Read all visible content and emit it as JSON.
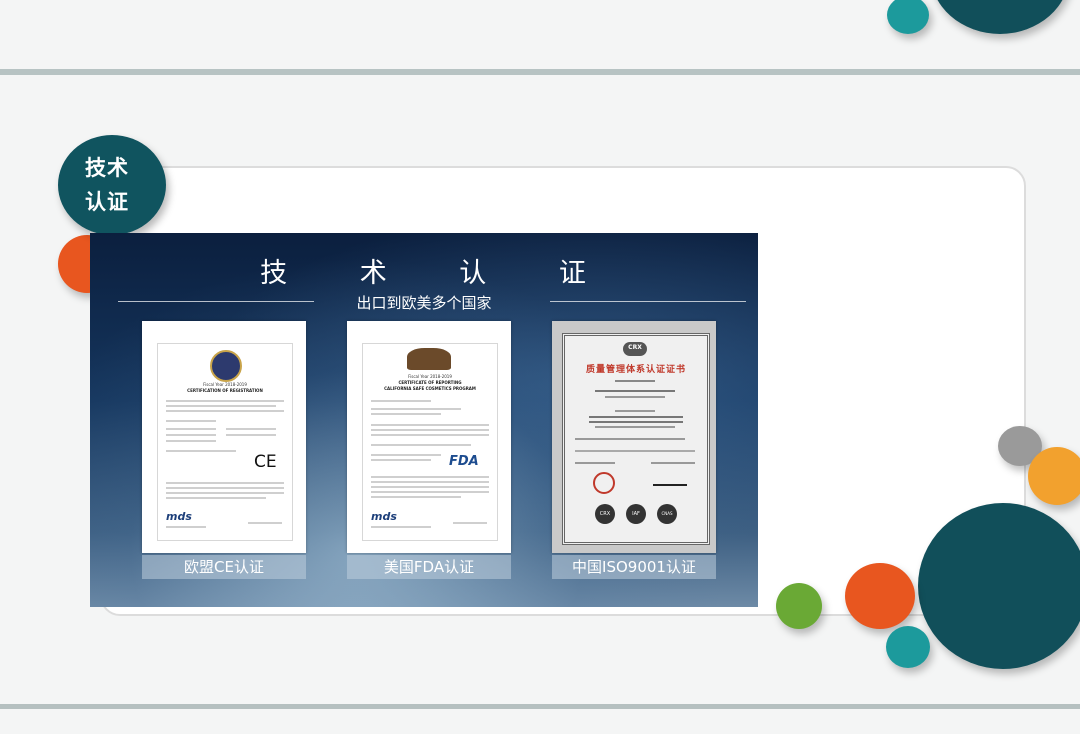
{
  "section": {
    "badge_label": "技术认证"
  },
  "banner": {
    "title": "技 术 认 证",
    "subtitle": "出口到欧美多个国家"
  },
  "certificates": [
    {
      "caption": "欧盟CE认证",
      "heading_year": "Fiscal Year 2018-2019",
      "heading": "CERTIFICATION OF REGISTRATION",
      "mark": "CE",
      "issuer": "mds"
    },
    {
      "caption": "美国FDA认证",
      "heading_year": "Fiscal Year 2018-2019",
      "heading": "CERTIFICATE OF REPORTING",
      "heading2": "CALIFORNIA SAFE COSMETICS PROGRAM",
      "mark": "FDA",
      "issuer": "mds"
    },
    {
      "caption": "中国ISO9001认证",
      "heading": "质量管理体系认证证书",
      "logo_top": "CRX",
      "logos_bottom": [
        "CRX",
        "IAF",
        "CNAS"
      ]
    }
  ],
  "colors": {
    "teal_dark": "#10545f",
    "teal_light": "#1c9a9c",
    "orange_red": "#e8561f",
    "orange": "#f2a12e",
    "green": "#6aa935",
    "grey": "#9a9a9a"
  }
}
